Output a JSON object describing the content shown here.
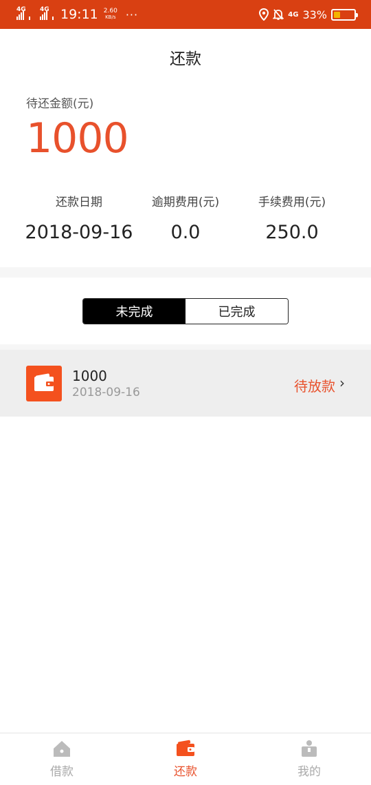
{
  "status_bar": {
    "network1": "4G",
    "network2": "4G",
    "time": "19:11",
    "speed_value": "2.60",
    "speed_unit": "KB/s",
    "more": "···",
    "net_badge": "4G",
    "battery_percent": "33%",
    "battery_level": 0.33,
    "battery_color": "#f4b400"
  },
  "header": {
    "title": "还款"
  },
  "summary": {
    "pending_label": "待还金额(元)",
    "pending_amount": "1000",
    "stats": [
      {
        "label": "还款日期",
        "value": "2018-09-16"
      },
      {
        "label": "逾期费用(元)",
        "value": "0.0"
      },
      {
        "label": "手续费用(元)",
        "value": "250.0"
      }
    ]
  },
  "segmented": {
    "tabs": [
      "未完成",
      "已完成"
    ],
    "active": 0
  },
  "records": [
    {
      "icon": "wallet-icon",
      "amount": "1000",
      "date": "2018-09-16",
      "status": "待放款"
    }
  ],
  "tabbar": {
    "items": [
      {
        "label": "借款",
        "icon": "home-icon"
      },
      {
        "label": "还款",
        "icon": "wallet-icon"
      },
      {
        "label": "我的",
        "icon": "person-icon"
      }
    ],
    "active": 1
  },
  "colors": {
    "accent": "#e8512c",
    "status_bar": "#d94012",
    "inactive": "#aaaaaa"
  }
}
